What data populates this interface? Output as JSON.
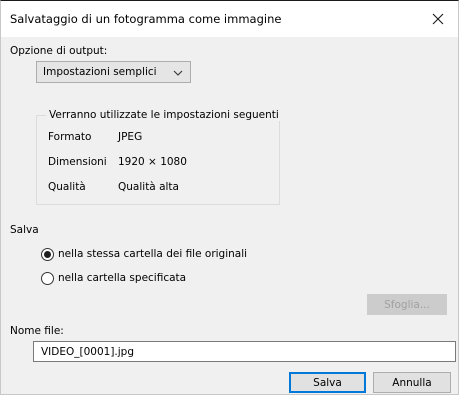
{
  "dialog": {
    "title": "Salvataggio di un fotogramma come immagine"
  },
  "output": {
    "label": "Opzione di output:",
    "selected": "Impostazioni semplici"
  },
  "settings_group": {
    "caption": "Verranno utilizzate le impostazioni seguenti",
    "rows": [
      {
        "key": "Formato",
        "value": "JPEG"
      },
      {
        "key": "Dimensioni",
        "value": "1920 × 1080"
      },
      {
        "key": "Qualità",
        "value": "Qualità alta"
      }
    ]
  },
  "save_section": {
    "label": "Salva",
    "options": [
      {
        "label": "nella stessa cartella dei file originali",
        "checked": true
      },
      {
        "label": "nella cartella specificata",
        "checked": false
      }
    ],
    "browse_label": "Sfoglia..."
  },
  "filename": {
    "label": "Nome file:",
    "value": "VIDEO_[0001].jpg"
  },
  "buttons": {
    "save": "Salva",
    "cancel": "Annulla"
  },
  "colors": {
    "accent": "#0078d7",
    "client_bg": "#f0f0f0"
  },
  "icons": {
    "close": "close-icon",
    "dropdown": "chevron-down-icon"
  }
}
